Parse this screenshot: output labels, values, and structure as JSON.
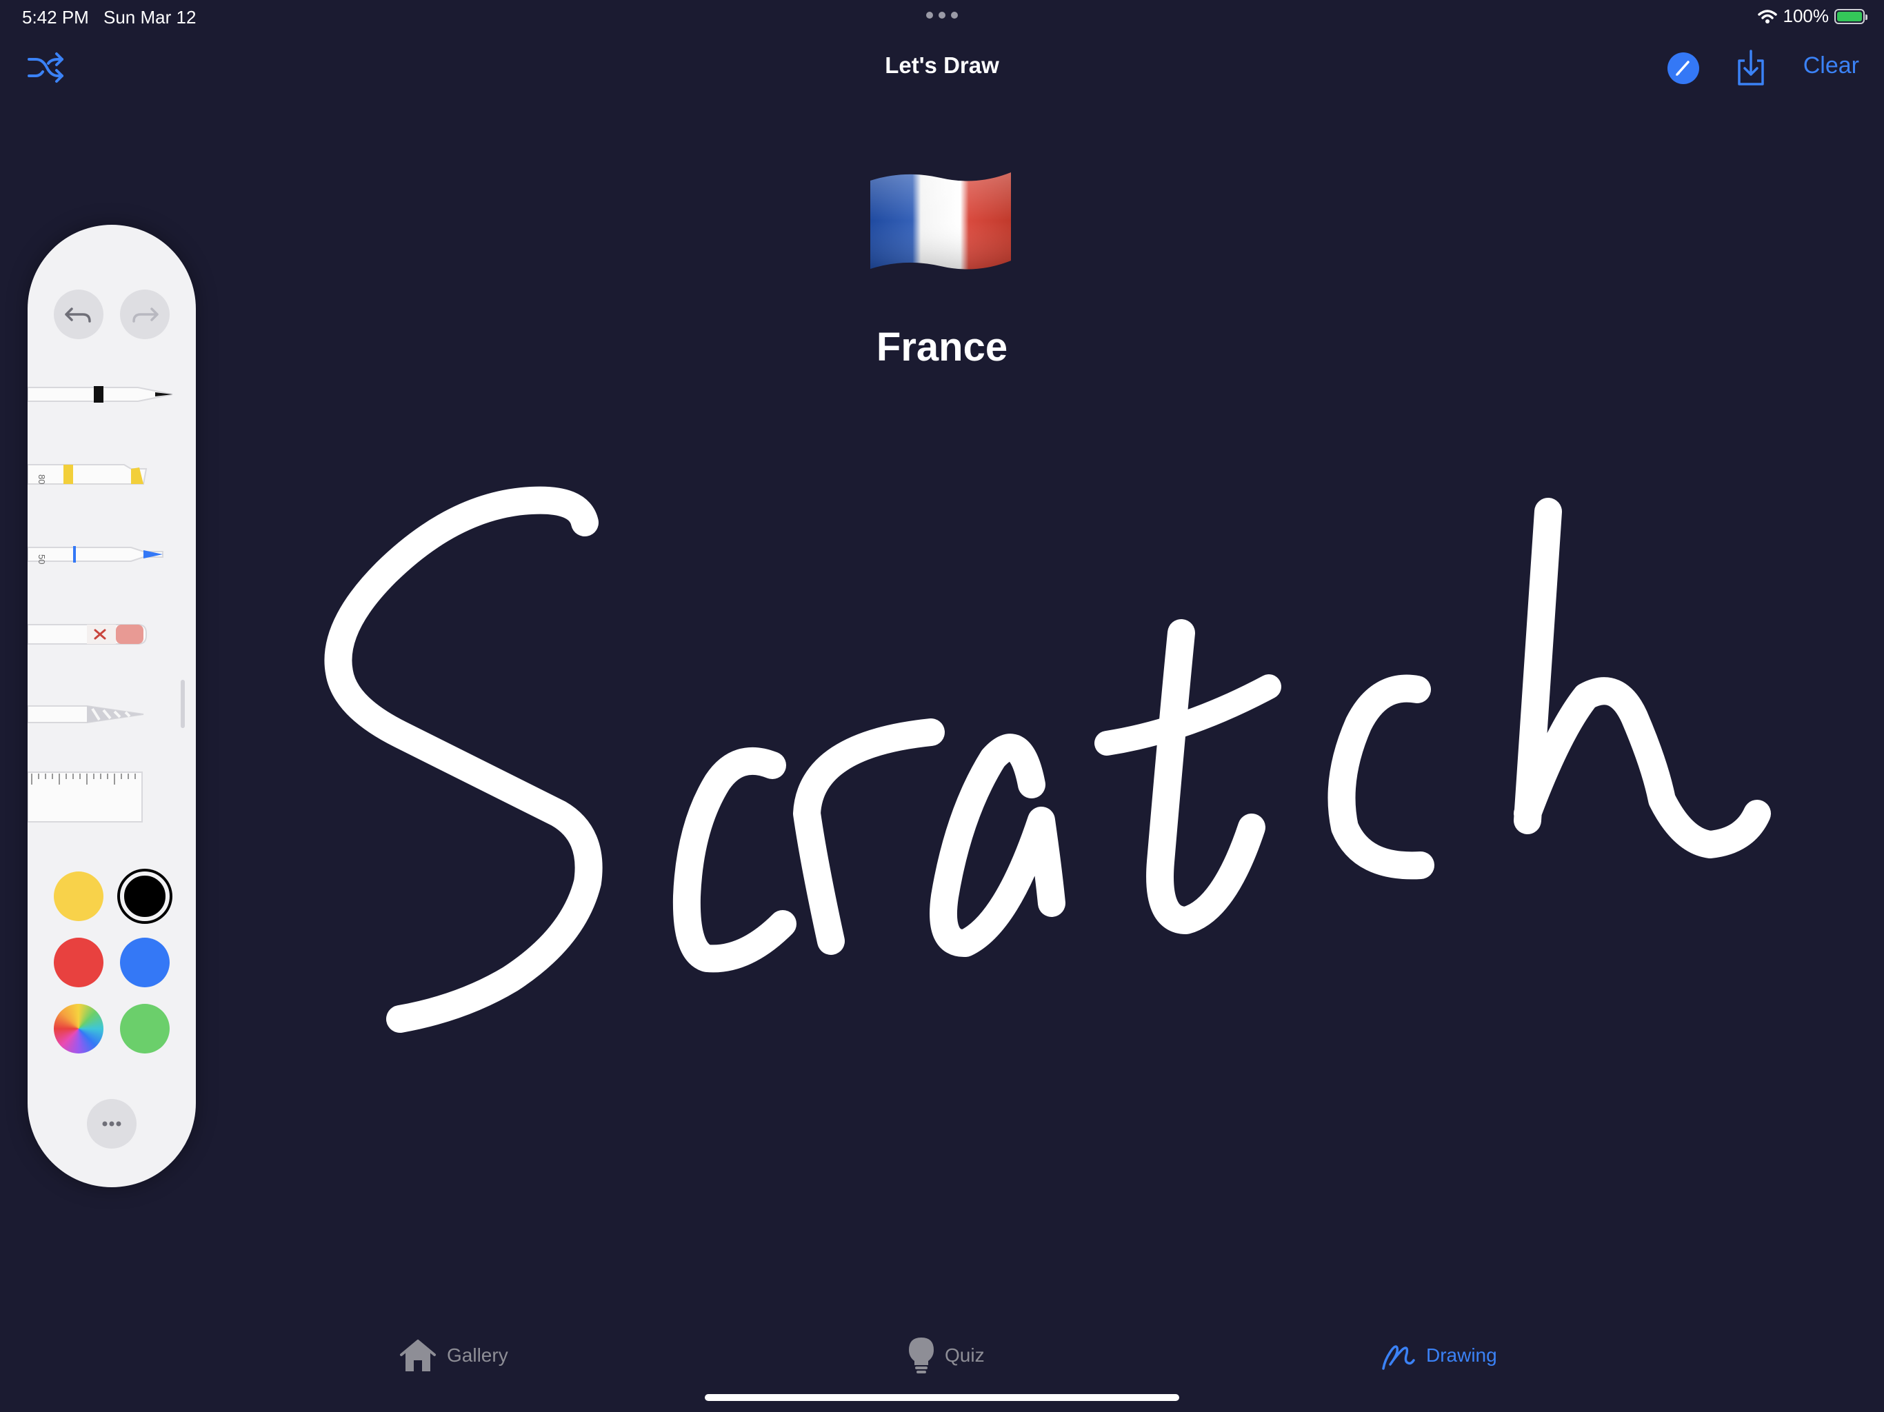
{
  "status": {
    "time": "5:42 PM",
    "date": "Sun Mar 12",
    "battery": "100%"
  },
  "nav": {
    "title": "Let's Draw",
    "clear_label": "Clear"
  },
  "prompt": {
    "flag_icon": "france-flag-icon",
    "country": "France"
  },
  "drawing": {
    "handwritten_text": "Scratch",
    "stroke_color": "#ffffff"
  },
  "palette": {
    "tools": [
      {
        "name": "pen",
        "label": ""
      },
      {
        "name": "highlighter",
        "label": "80"
      },
      {
        "name": "pencil",
        "label": "50"
      },
      {
        "name": "eraser",
        "label": ""
      },
      {
        "name": "lasso",
        "label": ""
      },
      {
        "name": "ruler",
        "label": ""
      }
    ],
    "colors": [
      {
        "name": "yellow",
        "hex": "#f8d24a"
      },
      {
        "name": "black",
        "hex": "#000000",
        "selected": true
      },
      {
        "name": "red",
        "hex": "#e8413f"
      },
      {
        "name": "blue",
        "hex": "#3478f6"
      },
      {
        "name": "multicolor",
        "hex": "spectrum"
      },
      {
        "name": "green",
        "hex": "#6bcf6b"
      }
    ]
  },
  "tabs": [
    {
      "label": "Gallery",
      "icon": "house-icon",
      "active": false
    },
    {
      "label": "Quiz",
      "icon": "lightbulb-icon",
      "active": false
    },
    {
      "label": "Drawing",
      "icon": "scribble-icon",
      "active": true
    }
  ],
  "colors": {
    "background": "#1b1b31",
    "accent": "#3b82f6",
    "inactive_tab": "#8e8e96"
  }
}
